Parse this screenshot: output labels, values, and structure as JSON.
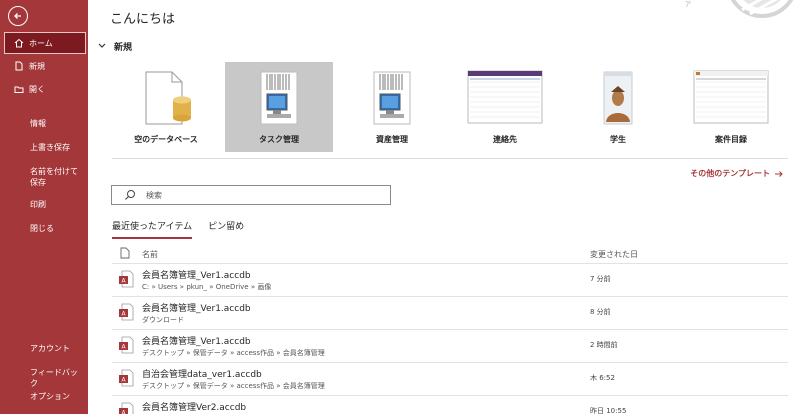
{
  "sidebar": {
    "items": [
      {
        "label": "ホーム",
        "icon": "home-icon"
      },
      {
        "label": "新規",
        "icon": "new-document-icon"
      },
      {
        "label": "開く",
        "icon": "folder-icon"
      }
    ],
    "links": [
      "情報",
      "上書き保存",
      "名前を付けて保存",
      "印刷",
      "閉じる"
    ],
    "bottom": [
      "アカウント",
      "フィードバック",
      "オプション"
    ]
  },
  "main": {
    "greeting": "こんにちは",
    "new_section": "新規",
    "templates": [
      {
        "label": "空のデータベース"
      },
      {
        "label": "タスク管理"
      },
      {
        "label": "資産管理"
      },
      {
        "label": "連絡先"
      },
      {
        "label": "学生"
      },
      {
        "label": "案件目録"
      }
    ],
    "more_templates": "その他のテンプレート",
    "search": {
      "placeholder": "検索"
    },
    "tabs": [
      {
        "label": "最近使ったアイテム",
        "active": true
      },
      {
        "label": "ピン留め",
        "active": false
      }
    ],
    "list_header": {
      "name": "名前",
      "date": "変更された日"
    },
    "files": [
      {
        "name": "会員名簿管理_Ver1.accdb",
        "path": "C: » Users » pkun_ » OneDrive » 画像",
        "date": "7 分前"
      },
      {
        "name": "会員名簿管理_Ver1.accdb",
        "path": "ダウンロード",
        "date": "8 分前"
      },
      {
        "name": "会員名簿管理_Ver1.accdb",
        "path": "デスクトップ » 保管データ » access作品 » 会員名簿管理",
        "date": "2 時間前"
      },
      {
        "name": "自治会管理data_ver1.accdb",
        "path": "デスクトップ » 保管データ » access作品 » 会員名簿管理",
        "date": "木 6:52"
      },
      {
        "name": "会員名簿管理Ver2.accdb",
        "path": "",
        "date": "昨日 10:55"
      }
    ]
  },
  "colors": {
    "accent": "#a4373a",
    "accent_dark": "#7c1a1f"
  }
}
